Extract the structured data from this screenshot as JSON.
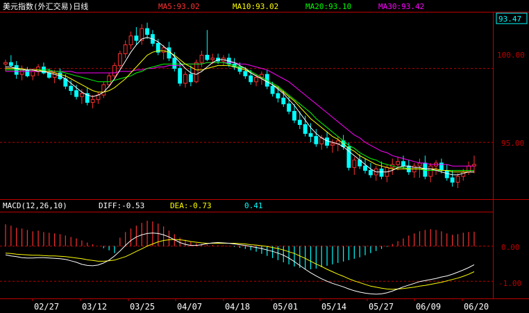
{
  "header": {
    "title": "美元指数(外汇交易)日线",
    "ma5": "MA5:93.02",
    "ma10": "MA10:93.02",
    "ma20": "MA20:93.10",
    "ma30": "MA30:93.42"
  },
  "macd_header": {
    "name": "MACD(12,26,10)",
    "diff": "DIFF:-0.53",
    "dea": "DEA:-0.73",
    "macd": "0.41"
  },
  "colors": {
    "up": "#ff3030",
    "down": "#00ffff",
    "ma5": "#ffffff",
    "ma10": "#ffff00",
    "ma20": "#00ff00",
    "ma30": "#ff00ff",
    "axis": "#c00000"
  },
  "chart_data": [
    {
      "type": "candlestick",
      "title": "美元指数(外汇交易)日线",
      "x_labels": [
        "02/27",
        "03/12",
        "03/25",
        "04/07",
        "04/18",
        "05/01",
        "05/14",
        "05/27",
        "06/09",
        "06/20"
      ],
      "y_ticks": [
        "100.00",
        "95.00"
      ],
      "last_price": "93.47",
      "ylim": [
        91.2,
        103.6
      ],
      "candles": [
        [
          100.3,
          100.6,
          99.8,
          100.4
        ],
        [
          100.4,
          100.9,
          100.1,
          100.2
        ],
        [
          100.2,
          100.5,
          99.3,
          99.6
        ],
        [
          99.6,
          100.2,
          99.2,
          99.9
        ],
        [
          99.9,
          100.1,
          99.4,
          99.5
        ],
        [
          99.5,
          100.0,
          99.2,
          99.8
        ],
        [
          99.8,
          100.3,
          99.5,
          100.1
        ],
        [
          100.1,
          100.4,
          99.6,
          99.7
        ],
        [
          99.7,
          100.0,
          99.3,
          99.4
        ],
        [
          99.4,
          99.9,
          99.0,
          99.7
        ],
        [
          99.7,
          100.0,
          99.2,
          99.3
        ],
        [
          99.3,
          99.6,
          98.6,
          98.8
        ],
        [
          98.8,
          99.2,
          98.2,
          98.5
        ],
        [
          98.5,
          98.9,
          97.9,
          98.1
        ],
        [
          98.1,
          98.6,
          97.6,
          98.3
        ],
        [
          98.3,
          98.7,
          97.5,
          97.7
        ],
        [
          97.7,
          98.2,
          97.3,
          97.9
        ],
        [
          97.9,
          98.4,
          97.6,
          98.2
        ],
        [
          98.2,
          99.1,
          98.0,
          98.9
        ],
        [
          98.9,
          99.7,
          98.7,
          99.5
        ],
        [
          99.5,
          100.4,
          99.3,
          100.2
        ],
        [
          100.2,
          101.2,
          100.0,
          101.0
        ],
        [
          101.0,
          101.9,
          100.7,
          101.6
        ],
        [
          101.6,
          102.5,
          101.3,
          102.2
        ],
        [
          102.2,
          102.8,
          101.6,
          101.9
        ],
        [
          101.9,
          103.0,
          101.6,
          102.7
        ],
        [
          102.7,
          103.1,
          102.0,
          102.3
        ],
        [
          102.3,
          102.6,
          101.5,
          101.7
        ],
        [
          101.7,
          102.0,
          100.9,
          101.1
        ],
        [
          101.1,
          101.6,
          100.6,
          101.4
        ],
        [
          101.4,
          101.8,
          100.5,
          100.7
        ],
        [
          100.7,
          101.1,
          99.8,
          100.0
        ],
        [
          100.0,
          100.4,
          98.8,
          99.0
        ],
        [
          99.0,
          99.8,
          98.7,
          99.6
        ],
        [
          99.6,
          100.2,
          98.8,
          99.1
        ],
        [
          99.1,
          100.6,
          99.0,
          100.4
        ],
        [
          100.4,
          101.2,
          100.1,
          100.9
        ],
        [
          100.9,
          102.6,
          100.5,
          100.6
        ],
        [
          100.6,
          101.0,
          100.3,
          100.7
        ],
        [
          100.7,
          101.0,
          100.3,
          100.5
        ],
        [
          100.5,
          100.9,
          100.2,
          100.7
        ],
        [
          100.7,
          101.0,
          100.1,
          100.3
        ],
        [
          100.3,
          100.7,
          99.9,
          100.1
        ],
        [
          100.1,
          100.4,
          99.6,
          99.8
        ],
        [
          99.8,
          100.1,
          99.3,
          99.5
        ],
        [
          99.5,
          99.9,
          98.9,
          99.1
        ],
        [
          99.1,
          99.6,
          98.8,
          99.4
        ],
        [
          99.4,
          99.8,
          98.9,
          99.6
        ],
        [
          99.6,
          99.9,
          98.6,
          98.8
        ],
        [
          98.8,
          99.1,
          98.1,
          98.3
        ],
        [
          98.3,
          98.8,
          97.7,
          98.0
        ],
        [
          98.0,
          98.5,
          97.4,
          97.6
        ],
        [
          97.6,
          98.1,
          96.9,
          97.1
        ],
        [
          97.1,
          97.6,
          96.3,
          96.5
        ],
        [
          96.5,
          97.1,
          95.9,
          96.2
        ],
        [
          96.2,
          96.8,
          95.4,
          95.6
        ],
        [
          95.6,
          96.3,
          95.0,
          95.4
        ],
        [
          95.4,
          95.9,
          94.7,
          94.9
        ],
        [
          94.9,
          95.5,
          94.5,
          95.3
        ],
        [
          95.3,
          95.7,
          94.6,
          94.8
        ],
        [
          94.8,
          95.2,
          94.3,
          94.9
        ],
        [
          94.9,
          95.4,
          94.4,
          95.1
        ],
        [
          95.1,
          95.5,
          94.5,
          94.7
        ],
        [
          94.7,
          95.0,
          93.1,
          93.3
        ],
        [
          93.3,
          94.0,
          92.8,
          93.8
        ],
        [
          93.8,
          94.2,
          93.2,
          93.4
        ],
        [
          93.4,
          93.9,
          92.9,
          93.1
        ],
        [
          93.1,
          93.6,
          92.6,
          92.8
        ],
        [
          92.8,
          93.4,
          92.4,
          93.2
        ],
        [
          93.2,
          93.7,
          92.5,
          92.7
        ],
        [
          92.7,
          93.5,
          92.3,
          93.3
        ],
        [
          93.3,
          93.9,
          92.8,
          93.5
        ],
        [
          93.5,
          94.0,
          93.1,
          93.7
        ],
        [
          93.7,
          94.1,
          93.2,
          93.4
        ],
        [
          93.4,
          93.8,
          92.8,
          93.0
        ],
        [
          93.0,
          93.6,
          92.6,
          93.4
        ],
        [
          93.4,
          93.9,
          92.6,
          93.6
        ],
        [
          93.6,
          94.1,
          92.5,
          92.7
        ],
        [
          92.7,
          93.6,
          92.3,
          93.4
        ],
        [
          93.4,
          93.8,
          92.8,
          93.6
        ],
        [
          93.6,
          93.9,
          92.9,
          93.1
        ],
        [
          93.1,
          93.5,
          92.4,
          92.6
        ],
        [
          92.6,
          93.1,
          92.0,
          92.3
        ],
        [
          92.3,
          92.9,
          91.9,
          92.7
        ],
        [
          92.7,
          93.2,
          92.4,
          93.0
        ],
        [
          93.0,
          93.7,
          92.8,
          93.4
        ],
        [
          93.4,
          94.1,
          92.9,
          93.5
        ]
      ],
      "ma5": [
        100.1,
        100.1,
        100.0,
        99.9,
        99.9,
        99.9,
        99.8,
        99.8,
        99.7,
        99.6,
        99.5,
        99.3,
        99.0,
        98.7,
        98.4,
        98.2,
        98.1,
        98.2,
        98.4,
        98.8,
        99.3,
        99.9,
        100.5,
        101.1,
        101.6,
        102.0,
        102.1,
        102.0,
        101.8,
        101.5,
        101.2,
        100.8,
        100.4,
        100.0,
        99.7,
        99.6,
        99.8,
        100.1,
        100.4,
        100.6,
        100.6,
        100.5,
        100.4,
        100.2,
        100.0,
        99.7,
        99.5,
        99.3,
        99.1,
        98.9,
        98.6,
        98.3,
        97.9,
        97.5,
        97.0,
        96.5,
        96.0,
        95.6,
        95.3,
        95.1,
        95.0,
        94.9,
        94.7,
        94.4,
        94.1,
        93.8,
        93.5,
        93.2,
        93.0,
        93.0,
        93.0,
        93.1,
        93.3,
        93.4,
        93.4,
        93.3,
        93.3,
        93.2,
        93.2,
        93.1,
        93.0,
        92.9,
        92.8,
        92.8,
        92.9,
        93.0,
        93.0
      ],
      "ma10": [
        100.0,
        100.0,
        100.0,
        100.0,
        99.9,
        99.9,
        99.9,
        99.8,
        99.8,
        99.7,
        99.6,
        99.5,
        99.3,
        99.1,
        98.9,
        98.7,
        98.5,
        98.4,
        98.4,
        98.5,
        98.7,
        99.0,
        99.3,
        99.7,
        100.1,
        100.5,
        100.9,
        101.1,
        101.2,
        101.2,
        101.1,
        100.9,
        100.6,
        100.3,
        100.1,
        99.9,
        99.9,
        100.0,
        100.1,
        100.2,
        100.2,
        100.2,
        100.1,
        100.0,
        99.9,
        99.7,
        99.5,
        99.3,
        99.1,
        98.9,
        98.7,
        98.4,
        98.1,
        97.8,
        97.4,
        97.0,
        96.6,
        96.3,
        96.0,
        95.7,
        95.4,
        95.2,
        94.9,
        94.6,
        94.4,
        94.1,
        93.9,
        93.7,
        93.5,
        93.4,
        93.3,
        93.2,
        93.2,
        93.2,
        93.2,
        93.2,
        93.2,
        93.2,
        93.2,
        93.2,
        93.1,
        93.1,
        93.0,
        93.0,
        93.0,
        93.0,
        93.0
      ],
      "ma20": [
        99.9,
        99.9,
        99.9,
        99.9,
        99.9,
        99.9,
        99.9,
        99.9,
        99.9,
        99.8,
        99.8,
        99.7,
        99.6,
        99.5,
        99.4,
        99.3,
        99.2,
        99.1,
        99.1,
        99.1,
        99.2,
        99.3,
        99.4,
        99.5,
        99.7,
        99.8,
        100.0,
        100.1,
        100.2,
        100.3,
        100.3,
        100.3,
        100.3,
        100.3,
        100.3,
        100.3,
        100.3,
        100.4,
        100.4,
        100.4,
        100.4,
        100.3,
        100.2,
        100.1,
        100.0,
        99.8,
        99.6,
        99.4,
        99.2,
        99.0,
        98.8,
        98.5,
        98.2,
        97.9,
        97.6,
        97.3,
        97.0,
        96.6,
        96.3,
        96.0,
        95.7,
        95.4,
        95.1,
        94.8,
        94.6,
        94.3,
        94.1,
        93.9,
        93.8,
        93.6,
        93.5,
        93.4,
        93.3,
        93.3,
        93.2,
        93.2,
        93.2,
        93.1,
        93.1,
        93.1,
        93.1,
        93.1,
        93.1,
        93.1,
        93.1,
        93.1,
        93.1
      ],
      "ma30": [
        99.8,
        99.8,
        99.8,
        99.8,
        99.8,
        99.8,
        99.8,
        99.8,
        99.8,
        99.8,
        99.8,
        99.8,
        99.8,
        99.7,
        99.7,
        99.7,
        99.7,
        99.7,
        99.7,
        99.7,
        99.7,
        99.8,
        99.8,
        99.8,
        99.9,
        99.9,
        100.0,
        100.0,
        100.1,
        100.1,
        100.2,
        100.2,
        100.2,
        100.3,
        100.3,
        100.3,
        100.3,
        100.4,
        100.4,
        100.4,
        100.4,
        100.4,
        100.4,
        100.3,
        100.3,
        100.2,
        100.1,
        100.0,
        99.9,
        99.7,
        99.5,
        99.3,
        99.1,
        98.8,
        98.5,
        98.2,
        97.9,
        97.6,
        97.3,
        97.0,
        96.7,
        96.4,
        96.1,
        95.8,
        95.5,
        95.3,
        95.0,
        94.8,
        94.6,
        94.4,
        94.3,
        94.1,
        94.0,
        93.9,
        93.8,
        93.7,
        93.6,
        93.6,
        93.5,
        93.5,
        93.5,
        93.5,
        93.4,
        93.4,
        93.4,
        93.4,
        93.4
      ]
    },
    {
      "type": "macd",
      "title": "MACD(12,26,10)",
      "y_ticks": [
        "0.00",
        "-1.00"
      ],
      "ylim": [
        -1.45,
        0.92
      ],
      "diff": [
        -0.25,
        -0.28,
        -0.3,
        -0.33,
        -0.34,
        -0.34,
        -0.33,
        -0.33,
        -0.34,
        -0.35,
        -0.36,
        -0.38,
        -0.42,
        -0.46,
        -0.52,
        -0.55,
        -0.56,
        -0.54,
        -0.48,
        -0.4,
        -0.28,
        -0.14,
        0.02,
        0.16,
        0.26,
        0.32,
        0.36,
        0.37,
        0.36,
        0.32,
        0.26,
        0.18,
        0.1,
        0.05,
        0.02,
        0.02,
        0.04,
        0.07,
        0.09,
        0.1,
        0.09,
        0.08,
        0.06,
        0.04,
        0.02,
        -0.01,
        -0.04,
        -0.07,
        -0.11,
        -0.15,
        -0.2,
        -0.26,
        -0.34,
        -0.44,
        -0.55,
        -0.66,
        -0.76,
        -0.85,
        -0.93,
        -1.0,
        -1.06,
        -1.11,
        -1.16,
        -1.22,
        -1.27,
        -1.31,
        -1.34,
        -1.36,
        -1.37,
        -1.36,
        -1.33,
        -1.28,
        -1.22,
        -1.16,
        -1.11,
        -1.06,
        -1.01,
        -0.98,
        -0.95,
        -0.92,
        -0.88,
        -0.85,
        -0.8,
        -0.74,
        -0.68,
        -0.61,
        -0.53
      ],
      "dea": [
        -0.2,
        -0.21,
        -0.23,
        -0.24,
        -0.25,
        -0.26,
        -0.26,
        -0.27,
        -0.28,
        -0.28,
        -0.29,
        -0.3,
        -0.32,
        -0.34,
        -0.36,
        -0.39,
        -0.41,
        -0.43,
        -0.43,
        -0.42,
        -0.4,
        -0.35,
        -0.3,
        -0.23,
        -0.15,
        -0.08,
        0.0,
        0.06,
        0.12,
        0.16,
        0.18,
        0.19,
        0.18,
        0.16,
        0.13,
        0.11,
        0.09,
        0.08,
        0.08,
        0.08,
        0.08,
        0.08,
        0.08,
        0.07,
        0.06,
        0.04,
        0.03,
        0.01,
        -0.01,
        -0.04,
        -0.07,
        -0.11,
        -0.16,
        -0.21,
        -0.28,
        -0.35,
        -0.43,
        -0.51,
        -0.58,
        -0.66,
        -0.73,
        -0.8,
        -0.86,
        -0.93,
        -0.99,
        -1.04,
        -1.09,
        -1.14,
        -1.17,
        -1.2,
        -1.22,
        -1.23,
        -1.22,
        -1.21,
        -1.19,
        -1.17,
        -1.14,
        -1.12,
        -1.09,
        -1.06,
        -1.03,
        -0.99,
        -0.95,
        -0.91,
        -0.86,
        -0.8,
        -0.73
      ],
      "macd": [
        0.62,
        0.58,
        0.52,
        0.5,
        0.46,
        0.42,
        0.44,
        0.4,
        0.38,
        0.36,
        0.34,
        0.3,
        0.26,
        0.22,
        0.16,
        0.1,
        0.05,
        0.0,
        -0.06,
        -0.12,
        -0.2,
        0.24,
        0.4,
        0.5,
        0.58,
        0.66,
        0.72,
        0.7,
        0.64,
        0.56,
        0.44,
        0.34,
        0.24,
        0.18,
        0.12,
        0.08,
        0.06,
        0.04,
        0.03,
        0.02,
        0.02,
        0.01,
        -0.02,
        -0.05,
        -0.08,
        -0.12,
        -0.16,
        -0.22,
        -0.28,
        -0.34,
        -0.4,
        -0.46,
        -0.52,
        -0.58,
        -0.62,
        -0.66,
        -0.66,
        -0.64,
        -0.6,
        -0.56,
        -0.52,
        -0.48,
        -0.44,
        -0.4,
        -0.36,
        -0.32,
        -0.26,
        -0.2,
        -0.14,
        -0.08,
        -0.02,
        0.06,
        0.14,
        0.22,
        0.3,
        0.36,
        0.42,
        0.46,
        0.48,
        0.46,
        0.42,
        0.36,
        0.32,
        0.34,
        0.38,
        0.4,
        0.41
      ]
    }
  ]
}
